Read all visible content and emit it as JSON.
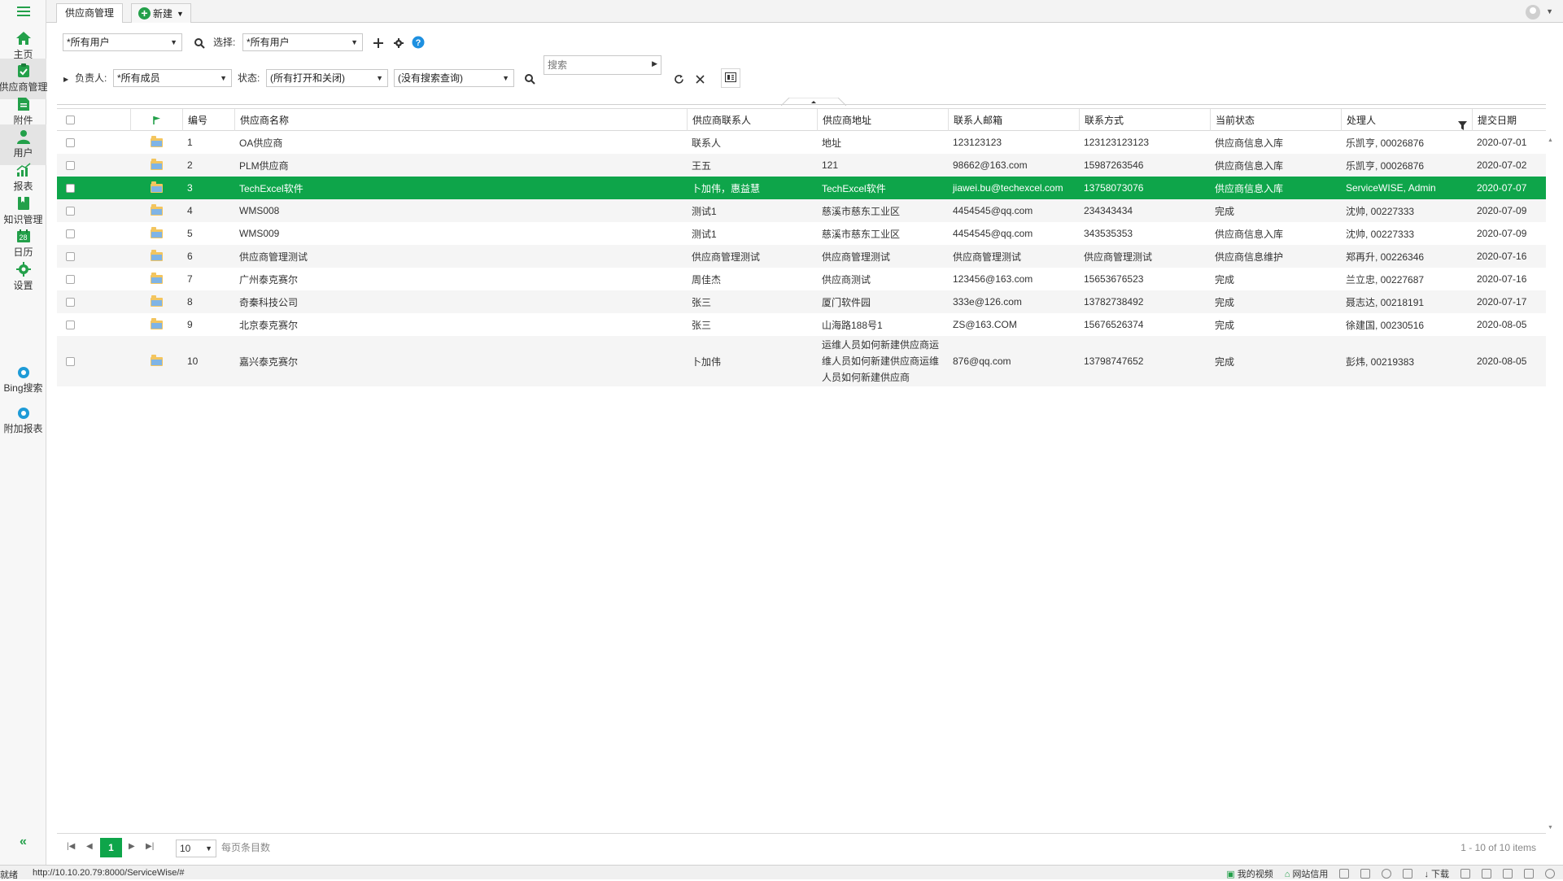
{
  "tabs": {
    "active": "供应商管理",
    "new": "新建"
  },
  "sidebar": {
    "items": [
      {
        "label": "主页",
        "icon": "home-icon"
      },
      {
        "label": "供应商管理",
        "icon": "clipboard-check-icon"
      },
      {
        "label": "附件",
        "icon": "document-icon"
      },
      {
        "label": "用户",
        "icon": "user-icon"
      },
      {
        "label": "报表",
        "icon": "chart-icon"
      },
      {
        "label": "知识管理",
        "icon": "book-icon"
      },
      {
        "label": "日历",
        "icon": "calendar-icon"
      },
      {
        "label": "设置",
        "icon": "gear-icon"
      },
      {
        "label": "Bing搜索",
        "icon": "tag-icon"
      },
      {
        "label": "附加报表",
        "icon": "tag-icon"
      }
    ],
    "calendar_day": "28",
    "collapse": "«"
  },
  "toolbar": {
    "user_select": "*所有用户",
    "select_label": "选择:",
    "select_value": "*所有用户"
  },
  "filters": {
    "owner_label": "负责人:",
    "owner_value": "*所有成员",
    "status_label": "状态:",
    "status_value": "(所有打开和关闭)",
    "query_value": "(没有搜索查询)",
    "search_placeholder": "搜索"
  },
  "table": {
    "headers": [
      "编号",
      "供应商名称",
      "供应商联系人",
      "供应商地址",
      "联系人邮箱",
      "联系方式",
      "当前状态",
      "处理人",
      "提交日期"
    ],
    "rows": [
      {
        "id": "1",
        "name": "OA供应商",
        "contact": "联系人",
        "address": "地址",
        "email": "123123123",
        "phone": "123123123123",
        "status": "供应商信息入库",
        "handler": "乐凯亨, 00026876",
        "date": "2020-07-01"
      },
      {
        "id": "2",
        "name": "PLM供应商",
        "contact": "王五",
        "address": "121",
        "email": "98662@163.com",
        "phone": "15987263546",
        "status": "供应商信息入库",
        "handler": "乐凯亨, 00026876",
        "date": "2020-07-02"
      },
      {
        "id": "3",
        "name": "TechExcel软件",
        "contact": "卜加伟，惠益慧",
        "address": "TechExcel软件",
        "email": "jiawei.bu@techexcel.com",
        "phone": "13758073076",
        "status": "供应商信息入库",
        "handler": "ServiceWISE, Admin",
        "date": "2020-07-07"
      },
      {
        "id": "4",
        "name": "WMS008",
        "contact": "测试1",
        "address": "慈溪市慈东工业区",
        "email": "4454545@qq.com",
        "phone": "234343434",
        "status": "完成",
        "handler": "沈帅, 00227333",
        "date": "2020-07-09"
      },
      {
        "id": "5",
        "name": "WMS009",
        "contact": "测试1",
        "address": "慈溪市慈东工业区",
        "email": "4454545@qq.com",
        "phone": "343535353",
        "status": "供应商信息入库",
        "handler": "沈帅, 00227333",
        "date": "2020-07-09"
      },
      {
        "id": "6",
        "name": "供应商管理测试",
        "contact": "供应商管理测试",
        "address": "供应商管理测试",
        "email": "供应商管理测试",
        "phone": "供应商管理测试",
        "status": "供应商信息维护",
        "handler": "郑再升, 00226346",
        "date": "2020-07-16"
      },
      {
        "id": "7",
        "name": "广州泰克赛尔",
        "contact": "周佳杰",
        "address": "供应商测试",
        "email": "123456@163.com",
        "phone": "15653676523",
        "status": "完成",
        "handler": "兰立忠, 00227687",
        "date": "2020-07-16"
      },
      {
        "id": "8",
        "name": "奇秦科技公司",
        "contact": "张三",
        "address": "厦门软件园",
        "email": "333e@126.com",
        "phone": "13782738492",
        "status": "完成",
        "handler": "聂志达, 00218191",
        "date": "2020-07-17"
      },
      {
        "id": "9",
        "name": "北京泰克赛尔",
        "contact": "张三",
        "address": "山海路188号1",
        "email": "ZS@163.COM",
        "phone": "15676526374",
        "status": "完成",
        "handler": "徐建国, 00230516",
        "date": "2020-08-05"
      },
      {
        "id": "10",
        "name": "嘉兴泰克赛尔",
        "contact": "卜加伟",
        "address": "运维人员如何新建供应商运维人员如何新建供应商运维人员如何新建供应商",
        "email": "876@qq.com",
        "phone": "13798747652",
        "status": "完成",
        "handler": "彭炜, 00219383",
        "date": "2020-08-05"
      }
    ]
  },
  "pager": {
    "current_page": "1",
    "page_size": "10",
    "per_page_label": "每页条目数",
    "items_count": "1 - 10 of 10 items"
  },
  "statusbar": {
    "left": "就绪",
    "url": "http://10.10.20.79:8000/ServiceWise/#",
    "video": "我的视频",
    "network": "网站信用",
    "download": "下载"
  },
  "colors": {
    "accent": "#0ea54a",
    "brand": "#23a04a"
  }
}
